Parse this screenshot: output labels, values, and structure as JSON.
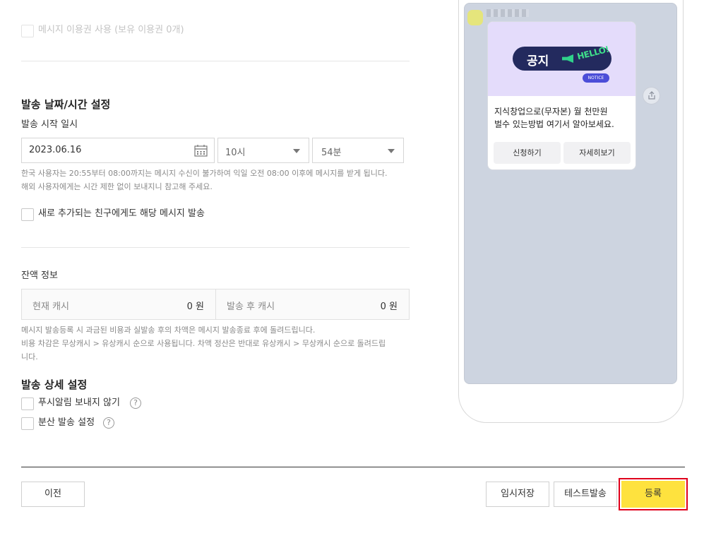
{
  "ticket": {
    "label": "메시지 이용권 사용 (보유 이용권 0개)"
  },
  "schedule": {
    "title": "발송 날짜/시간 설정",
    "start_label": "발송 시작 일시",
    "date": "2023.06.16",
    "hour": "10시",
    "minute": "54분",
    "notice_line1": "한국 사용자는 20:55부터 08:00까지는 메시지 수신이 불가하여 익일 오전 08:00 이후에 메시지를 받게 됩니다.",
    "notice_line2": "해외 사용자에게는 시간 제한 없이 보내지니 참고해 주세요.",
    "new_friends_label": "새로 추가되는 친구에게도 해당 메시지 발송"
  },
  "balance": {
    "title": "잔액 정보",
    "current_label": "현재 캐시",
    "current_value": "0 원",
    "after_label": "발송 후 캐시",
    "after_value": "0 원",
    "notice_line1": "메시지 발송등록 시 과금된 비용과 실발송 후의 차액은 메시지 발송종료 후에 돌려드립니다.",
    "notice_line2": "비용 차감은 무상캐시 > 유상캐시 순으로 사용됩니다. 차액 정산은 반대로 유상캐시 > 무상캐시 순으로 돌려드립",
    "notice_line3": "니다."
  },
  "detail": {
    "title": "발송 상세 설정",
    "no_push_label": "푸시알림 보내지 않기",
    "split_label": "분산 발송 설정",
    "help_glyph": "?"
  },
  "footer": {
    "prev": "이전",
    "draft": "임시저장",
    "test": "테스트발송",
    "register": "등록"
  },
  "preview": {
    "banner_text": "공지",
    "banner_hello": "HELLO!",
    "banner_tag": "NOTICE",
    "message_line1": "지식창업으로(무자본) 월 천만원",
    "message_line2": "벌수 있는방법 여기서 알아보세요.",
    "button1": "신청하기",
    "button2": "자세히보기",
    "share_icon": "share-icon"
  },
  "colors": {
    "register_bg": "#fee23e",
    "register_highlight": "#e0001b",
    "banner_bg": "#e4dcfb",
    "preview_bg": "#cdd4e0"
  }
}
